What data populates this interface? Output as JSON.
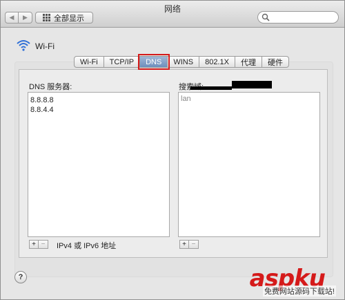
{
  "window": {
    "title": "网络"
  },
  "toolbar": {
    "show_all_label": "全部显示",
    "search_placeholder": ""
  },
  "header": {
    "interface_name": "Wi-Fi"
  },
  "tabs": [
    {
      "label": "Wi-Fi",
      "active": false
    },
    {
      "label": "TCP/IP",
      "active": false
    },
    {
      "label": "DNS",
      "active": true
    },
    {
      "label": "WINS",
      "active": false
    },
    {
      "label": "802.1X",
      "active": false
    },
    {
      "label": "代理",
      "active": false
    },
    {
      "label": "硬件",
      "active": false
    }
  ],
  "dns": {
    "servers_label": "DNS 服务器:",
    "servers": [
      "8.8.8.8",
      "8.8.4.4"
    ],
    "search_domains_label": "搜索域:",
    "search_domains": [
      "lan"
    ],
    "address_hint": "IPv4 或 IPv6 地址",
    "add_symbol": "+",
    "remove_symbol": "−"
  },
  "help": {
    "symbol": "?"
  },
  "watermark": {
    "brand": "aspku",
    "subtitle": "免费网站源码下载站!"
  },
  "colors": {
    "active_tab": "#7b9bc8",
    "highlight_outline": "#d41a1a",
    "watermark": "#d51a1a"
  }
}
